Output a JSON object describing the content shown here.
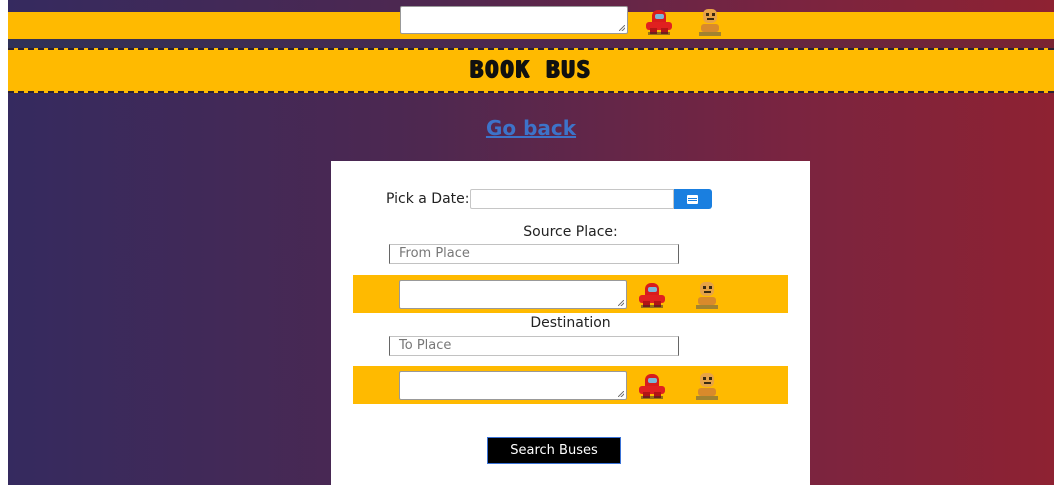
{
  "header": {
    "title": "BOOK BUS"
  },
  "nav": {
    "go_back": "Go back"
  },
  "form": {
    "date_label": "Pick a Date:",
    "date_value": "",
    "source_label": "Source Place:",
    "source_placeholder": "From Place",
    "destination_label": "Destination",
    "destination_placeholder": "To Place",
    "search_button": "Search Buses"
  },
  "icons": {
    "calendar": "calendar-icon",
    "sprite_red": "red-crewmate-sprite",
    "sprite_orange": "orange-skeleton-sprite"
  },
  "colors": {
    "accent_yellow": "#ffba00",
    "link_blue": "#3d73c9",
    "calendar_button": "#1a7fe0",
    "gradient_left": "#352a5f",
    "gradient_right": "#8e2232"
  }
}
